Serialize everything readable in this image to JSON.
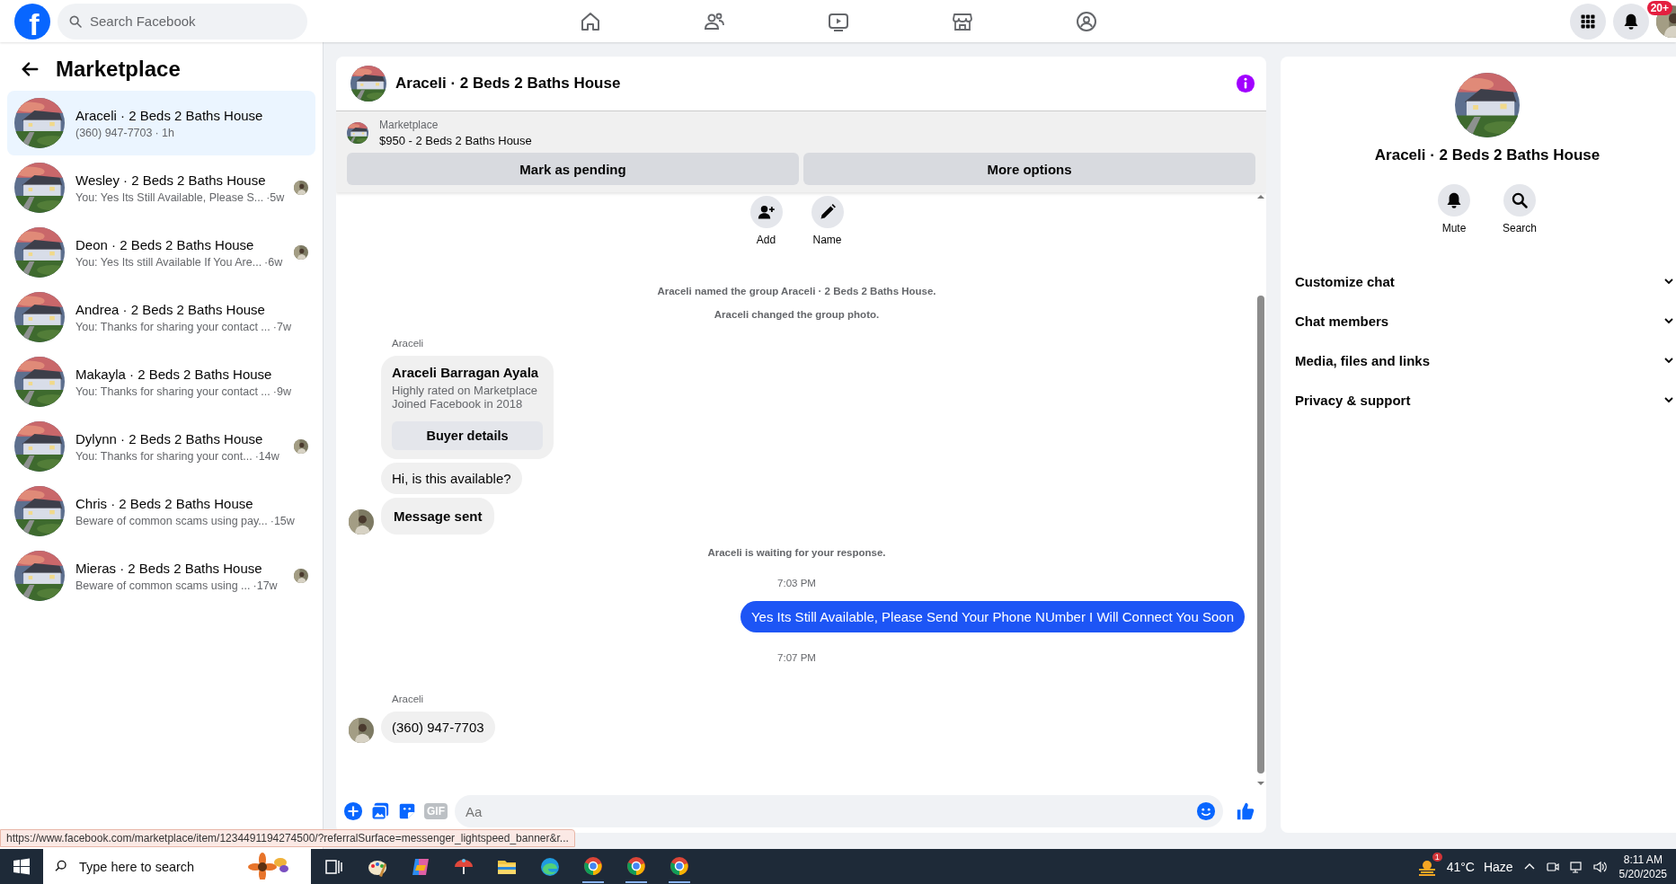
{
  "topbar": {
    "logo": "f",
    "search_placeholder": "Search Facebook",
    "notification_badge": "20+"
  },
  "sidebar": {
    "title": "Marketplace",
    "conversations": [
      {
        "name": "Araceli · 2 Beds 2 Baths House",
        "preview": "(360) 947-7703",
        "time": "· 1h",
        "selected": true,
        "seen_avatar": false
      },
      {
        "name": "Wesley · 2 Beds 2 Baths House",
        "preview": "You: Yes Its Still Available, Please S...",
        "time": "·5w",
        "selected": false,
        "seen_avatar": true
      },
      {
        "name": "Deon · 2 Beds 2 Baths House",
        "preview": "You: Yes Its still Available If You Are...",
        "time": "·6w",
        "selected": false,
        "seen_avatar": true
      },
      {
        "name": "Andrea · 2 Beds 2 Baths House",
        "preview": "You: Thanks for sharing your contact ...",
        "time": "·7w",
        "selected": false,
        "seen_avatar": false
      },
      {
        "name": "Makayla · 2 Beds 2 Baths House",
        "preview": "You: Thanks for sharing your contact ...",
        "time": "·9w",
        "selected": false,
        "seen_avatar": false
      },
      {
        "name": "Dylynn · 2 Beds 2 Baths House",
        "preview": "You: Thanks for sharing your cont...",
        "time": "·14w",
        "selected": false,
        "seen_avatar": true
      },
      {
        "name": "Chris · 2 Beds 2 Baths House",
        "preview": "Beware of common scams using pay...",
        "time": "·15w",
        "selected": false,
        "seen_avatar": false
      },
      {
        "name": "Mieras · 2 Beds 2 Baths House",
        "preview": "Beware of common scams using ...",
        "time": "·17w",
        "selected": false,
        "seen_avatar": true
      }
    ]
  },
  "chat": {
    "title": "Araceli · 2 Beds 2 Baths House",
    "listing": {
      "label": "Marketplace",
      "title": "$950 - 2 Beds 2 Baths House"
    },
    "buttons": [
      "Mark as pending",
      "More options"
    ],
    "actions": [
      {
        "kind": "add",
        "label": "Add"
      },
      {
        "kind": "name",
        "label": "Name"
      }
    ],
    "messages": [
      {
        "kind": "system",
        "text": "Araceli named the group Araceli · 2 Beds 2 Baths House."
      },
      {
        "kind": "system",
        "text": "Araceli changed the group photo."
      },
      {
        "kind": "sender",
        "text": "Araceli"
      },
      {
        "kind": "card",
        "title": "Araceli Barragan Ayala",
        "lines": [
          "Highly rated on Marketplace",
          "Joined Facebook in 2018"
        ],
        "button": "Buyer details"
      },
      {
        "kind": "incoming",
        "text": "Hi, is this available?",
        "avatar": false,
        "emphasis": false
      },
      {
        "kind": "incoming",
        "text": "Message sent",
        "avatar": true,
        "emphasis": true
      },
      {
        "kind": "system",
        "text": "Araceli is waiting for your response."
      },
      {
        "kind": "time",
        "text": "7:03 PM"
      },
      {
        "kind": "outgoing",
        "text": "Yes Its Still Available, Please Send Your Phone NUmber I Will Connect You Soon"
      },
      {
        "kind": "time",
        "text": "7:07 PM"
      },
      {
        "kind": "sender",
        "text": "Araceli"
      },
      {
        "kind": "incoming",
        "text": "(360) 947-7703",
        "avatar": true,
        "emphasis": false
      }
    ],
    "composer_placeholder": "Aa",
    "gif_label": "GIF"
  },
  "details": {
    "name": "Araceli · 2 Beds 2 Baths House",
    "actions": [
      {
        "kind": "mute",
        "label": "Mute"
      },
      {
        "kind": "search",
        "label": "Search"
      }
    ],
    "sections": [
      "Customize chat",
      "Chat members",
      "Media, files and links",
      "Privacy & support"
    ]
  },
  "status_url": "https://www.facebook.com/marketplace/item/1234491194274500/?referralSurface=messenger_lightspeed_banner&r...",
  "taskbar": {
    "search_placeholder": "Type here to search",
    "weather_badge": "1",
    "temperature": "41°C",
    "condition": "Haze",
    "time": "8:11 AM",
    "date": "5/20/2025"
  }
}
